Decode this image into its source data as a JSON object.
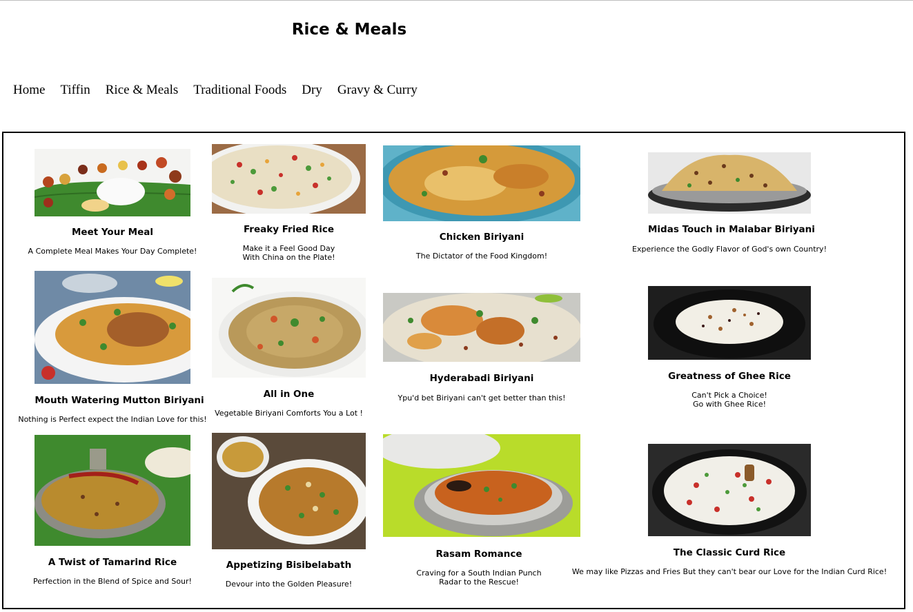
{
  "page": {
    "title": "Rice & Meals"
  },
  "nav": {
    "items": [
      "Home",
      "Tiffin",
      "Rice & Meals",
      "Traditional Foods",
      "Dry",
      "Gravy & Curry"
    ]
  },
  "dishes": [
    {
      "title": "Meet Your Meal",
      "lines": [
        "A Complete Meal Makes Your Day Complete!"
      ]
    },
    {
      "title": "Freaky Fried Rice",
      "lines": [
        "Make it a Feel Good Day",
        "With China on the Plate!"
      ]
    },
    {
      "title": "Chicken Biriyani",
      "lines": [
        "The Dictator of the Food Kingdom!"
      ]
    },
    {
      "title": "Midas Touch in Malabar Biriyani",
      "lines": [
        "Experience the Godly Flavor of God's own Country!"
      ]
    },
    {
      "title": "Mouth Watering Mutton Biriyani",
      "lines": [
        "Nothing is Perfect expect the Indian Love for this!"
      ]
    },
    {
      "title": "All in One",
      "lines": [
        "Vegetable Biriyani Comforts You a Lot !"
      ]
    },
    {
      "title": "Hyderabadi Biriyani",
      "lines": [
        "Ypu'd bet Biriyani can't get better than this!"
      ]
    },
    {
      "title": "Greatness of Ghee Rice",
      "lines": [
        "Can't Pick a Choice!",
        "Go with Ghee Rice!"
      ]
    },
    {
      "title": "A Twist of Tamarind Rice",
      "lines": [
        "Perfection in the Blend of Spice and Sour!"
      ]
    },
    {
      "title": "Appetizing Bisibelabath",
      "lines": [
        "Devour into the Golden Pleasure!"
      ]
    },
    {
      "title": "Rasam Romance",
      "lines": [
        "Craving for a South Indian Punch",
        "Radar to the Rescue!"
      ]
    },
    {
      "title": "The Classic Curd Rice",
      "lines": [
        "We may like Pizzas and Fries But they can't bear our Love for the Indian Curd Rice!"
      ]
    }
  ]
}
